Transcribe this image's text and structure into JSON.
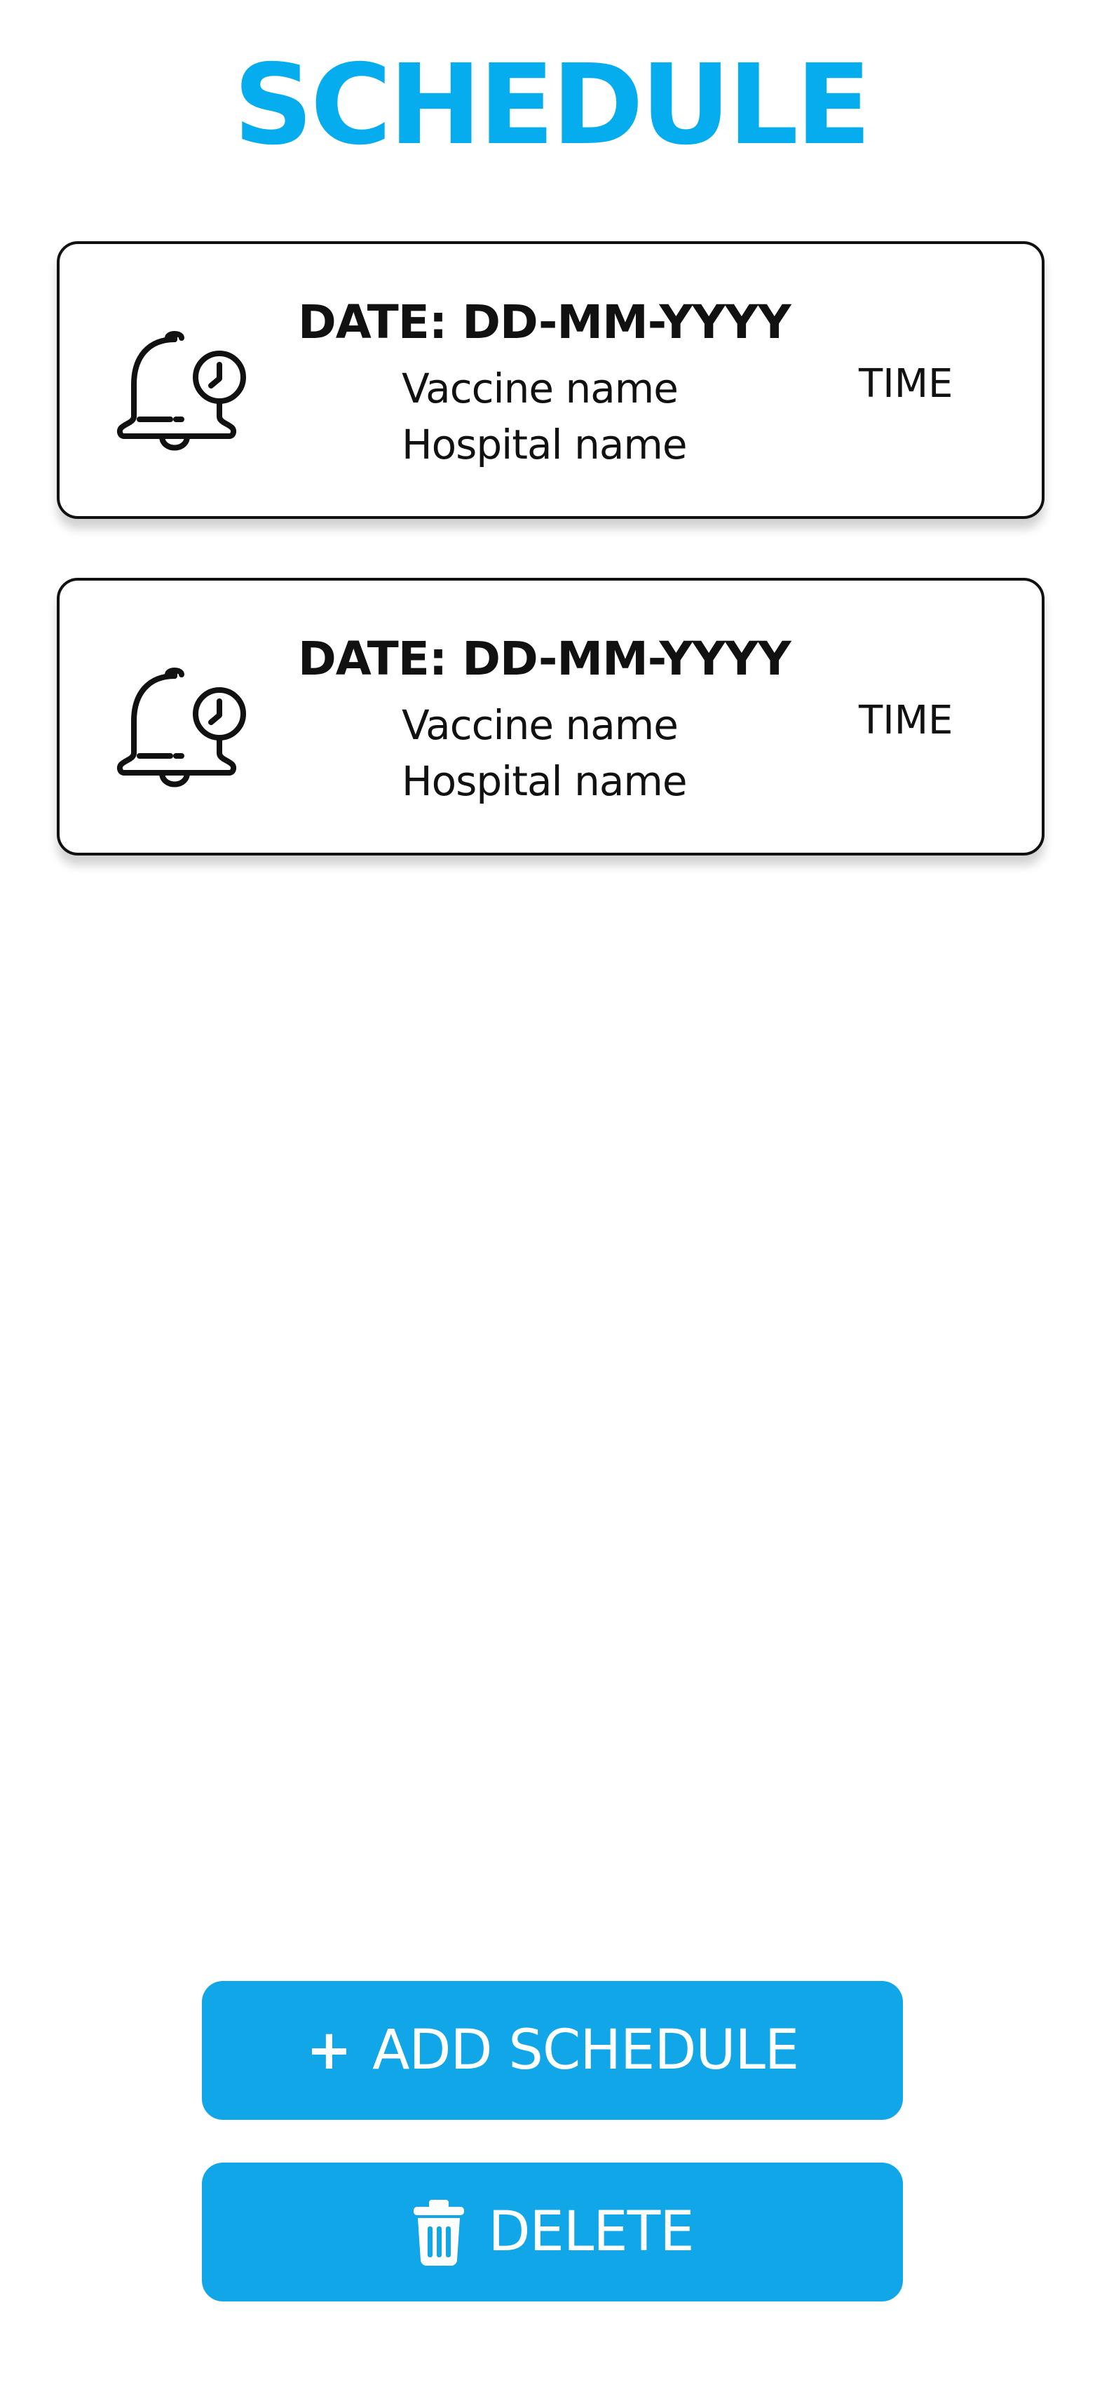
{
  "page": {
    "title": "SCHEDULE"
  },
  "schedules": [
    {
      "date": "DATE: DD-MM-YYYY",
      "vaccine": "Vaccine name",
      "hospital": "Hospital name",
      "time": "TIME",
      "icon": "bell-clock-icon"
    },
    {
      "date": "DATE: DD-MM-YYYY",
      "vaccine": "Vaccine name",
      "hospital": "Hospital name",
      "time": "TIME",
      "icon": "bell-clock-icon"
    }
  ],
  "actions": {
    "add": {
      "icon": "plus-icon",
      "label": "ADD SCHEDULE"
    },
    "delete": {
      "icon": "trash-icon",
      "label": "DELETE"
    }
  },
  "colors": {
    "title": "#05adef",
    "button": "#10a6e7",
    "text": "#111111"
  }
}
